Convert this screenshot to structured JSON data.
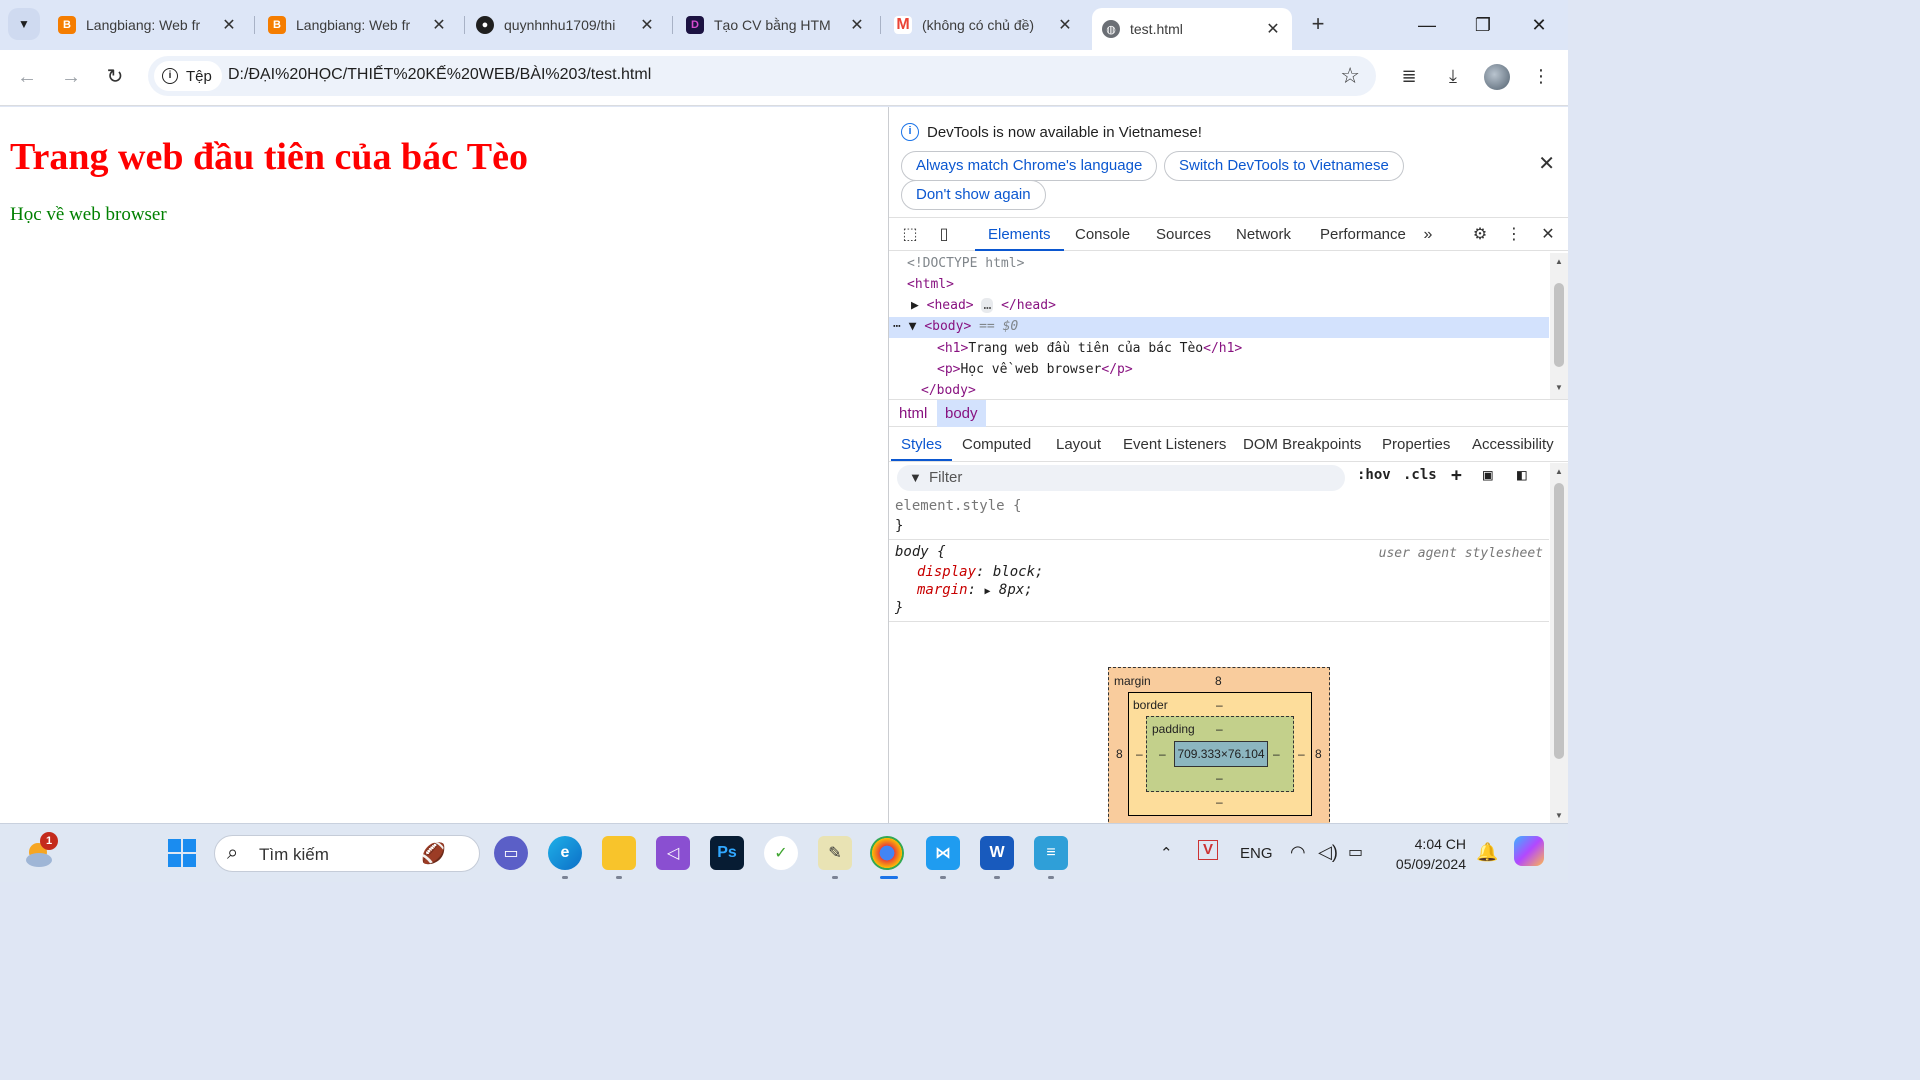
{
  "browser": {
    "tabs": [
      {
        "title": "Langbiang: Web fr",
        "icon": "blogger-icon"
      },
      {
        "title": "Langbiang: Web fr",
        "icon": "blogger-icon"
      },
      {
        "title": "quynhnhu1709/thi",
        "icon": "github-icon"
      },
      {
        "title": "Tạo CV bằng HTM",
        "icon": "topcv-icon"
      },
      {
        "title": "(không có chủ đề)",
        "icon": "gmail-icon"
      },
      {
        "title": "test.html",
        "icon": "globe-icon"
      }
    ],
    "active_tab": 5,
    "site_chip": "Tệp",
    "url": "D:/ĐẠI%20HỌC/THIẾT%20KẾ%20WEB/BÀI%203/test.html"
  },
  "page": {
    "heading": "Trang web đầu tiên của bác Tèo",
    "paragraph": "Học về web browser",
    "heading_color": "#ff0000",
    "paragraph_color": "#008000"
  },
  "devtools": {
    "infobar": {
      "message": "DevTools is now available in Vietnamese!",
      "btn_match": "Always match Chrome's language",
      "btn_switch": "Switch DevTools to Vietnamese",
      "btn_dont": "Don't show again"
    },
    "tabs": [
      "Elements",
      "Console",
      "Sources",
      "Network",
      "Performance"
    ],
    "dom": {
      "doctype": "<!DOCTYPE html>",
      "html_open": "<html>",
      "head_open": "<head>",
      "head_ellipsis": "…",
      "head_close": "</head>",
      "body_open": "<body>",
      "body_hint": "== $0",
      "h1_open": "<h1>",
      "h1_text": "Trang web đầu tiên của bác Tèo",
      "h1_close": "</h1>",
      "p_open": "<p>",
      "p_text": "Học về web browser",
      "p_close": "</p>",
      "body_close": "</body>"
    },
    "breadcrumbs": [
      "html",
      "body"
    ],
    "subtabs": [
      "Styles",
      "Computed",
      "Layout",
      "Event Listeners",
      "DOM Breakpoints",
      "Properties",
      "Accessibility"
    ],
    "filter_placeholder": "Filter",
    "hov": ":hov",
    "cls": ".cls",
    "styles": {
      "element_style": "element.style {",
      "close_brace": "}",
      "body_selector": "body {",
      "source": "user agent stylesheet",
      "prop1_name": "display",
      "prop1_value": "block;",
      "prop2_name": "margin",
      "prop2_value": "8px;"
    },
    "box_model": {
      "margin_label": "margin",
      "margin_value": "8",
      "margin_left": "8",
      "margin_right": "8",
      "border_label": "border",
      "border_value": "–",
      "padding_label": "padding",
      "padding_value": "–",
      "content": "709.333×76.104",
      "dash": "–"
    }
  },
  "taskbar": {
    "search_placeholder": "Tìm kiếm",
    "weather_badge": "1",
    "lang": "ENG",
    "time": "4:04 CH",
    "date": "05/09/2024"
  }
}
